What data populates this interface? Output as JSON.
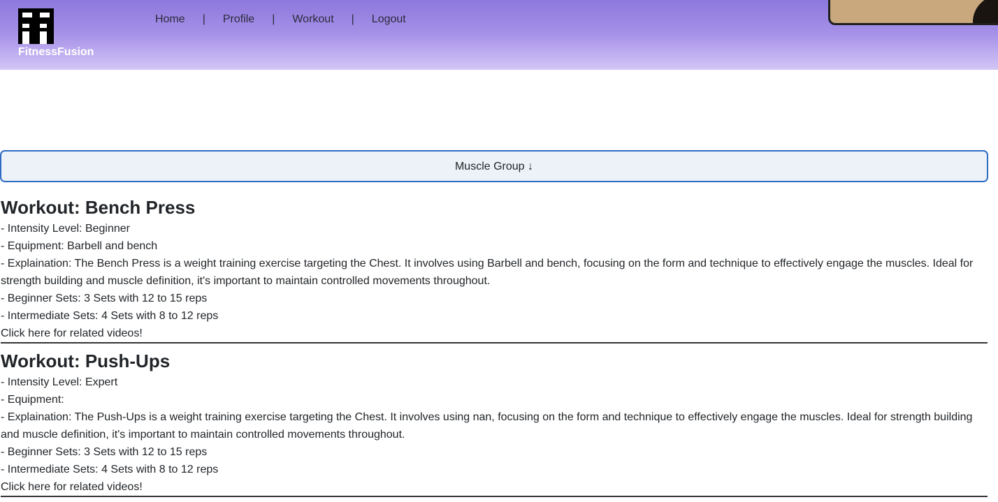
{
  "brand": {
    "name": "FitnessFusion",
    "logo_icon": "ff-logo-icon"
  },
  "nav": {
    "items": [
      {
        "label": "Home"
      },
      {
        "label": "Profile"
      },
      {
        "label": "Workout"
      },
      {
        "label": "Logout"
      }
    ],
    "separator": "|"
  },
  "filter": {
    "label": "Muscle Group ↓"
  },
  "workouts": [
    {
      "title": "Workout: Bench Press",
      "intensity": "- Intensity Level: Beginner",
      "equipment": "- Equipment: Barbell and bench",
      "explanation": "- Explaination: The Bench Press is a weight training exercise targeting the Chest. It involves using Barbell and bench, focusing on the form and technique to effectively engage the muscles. Ideal for strength building and muscle definition, it's important to maintain controlled movements throughout.",
      "beginner_sets": "- Beginner Sets: 3 Sets with 12 to 15 reps",
      "intermediate_sets": "- Intermediate Sets: 4 Sets with 8 to 12 reps",
      "video_link": "Click here for related videos!"
    },
    {
      "title": "Workout: Push-Ups",
      "intensity": "- Intensity Level: Expert",
      "equipment": "- Equipment:",
      "explanation": "- Explaination: The Push-Ups is a weight training exercise targeting the Chest. It involves using nan, focusing on the form and technique to effectively engage the muscles. Ideal for strength building and muscle definition, it's important to maintain controlled movements throughout.",
      "beginner_sets": "- Beginner Sets: 3 Sets with 12 to 15 reps",
      "intermediate_sets": "- Intermediate Sets: 4 Sets with 8 to 12 reps",
      "video_link": "Click here for related videos!"
    }
  ],
  "colors": {
    "header_gradient_top": "#8d78dd",
    "header_gradient_bottom": "#d4c6f6",
    "filter_border": "#2e6bc4",
    "filter_bg": "#edf2f8"
  }
}
